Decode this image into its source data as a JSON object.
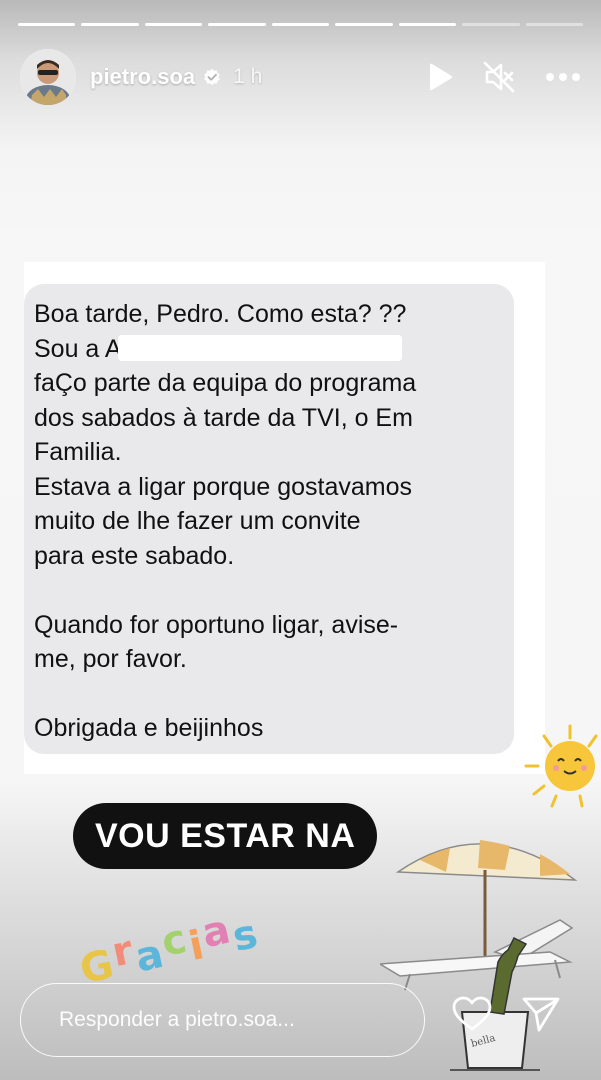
{
  "progress": {
    "total": 9,
    "completed": 7
  },
  "header": {
    "username": "pietro.soa",
    "time_ago": "1 h",
    "icons": [
      "play-icon",
      "muted-icon",
      "more-icon"
    ]
  },
  "message": {
    "lines": [
      "Boa tarde, Pedro. Como esta? ??",
      "Sou a Ar                         o e",
      "faÇo parte da equipa do programa",
      "dos sabados à tarde da TVI, o Em",
      "Familia.",
      "Estava a ligar porque gostavamos",
      "muito de lhe fazer um convite",
      "para este sabado.",
      "",
      "Quando for oportuno ligar, avise-",
      "me, por favor.",
      "",
      "Obrigada e beijinhos"
    ]
  },
  "stickers": {
    "caption": "VOU ESTAR NA",
    "gracias": [
      "G",
      "r",
      "a",
      "c",
      "i",
      "a",
      "s"
    ],
    "gracias_colors": [
      "#e8c547",
      "#f28c7a",
      "#5cb6d9",
      "#a3d16c",
      "#f4a05a",
      "#e27fb3",
      "#5cb6d9"
    ],
    "sun_icon": "sun-icon",
    "beach_icon": "beach-umbrella-icon"
  },
  "footer": {
    "reply_placeholder": "Responder a pietro.soa..."
  }
}
